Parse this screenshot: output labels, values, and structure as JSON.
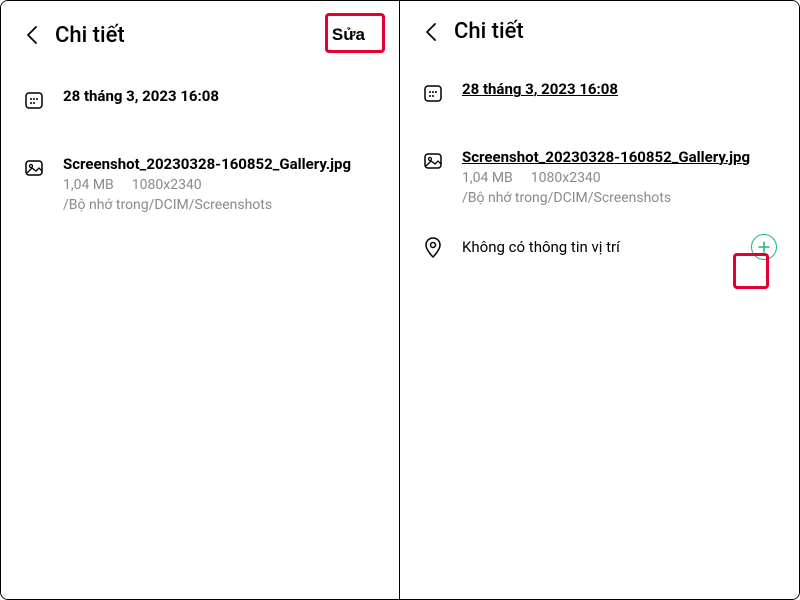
{
  "left": {
    "header_title": "Chi tiết",
    "edit_label": "Sửa",
    "date": "28 tháng 3, 2023 16:08",
    "filename": "Screenshot_20230328-160852_Gallery.jpg",
    "filesize": "1,04 MB",
    "dimensions": "1080x2340",
    "path": "/Bộ nhớ trong/DCIM/Screenshots"
  },
  "right": {
    "header_title": "Chi tiết",
    "date": "28 tháng 3, 2023 16:08",
    "filename": "Screenshot_20230328-160852_Gallery.jpg",
    "filesize": "1,04 MB",
    "dimensions": "1080x2340",
    "path": "/Bộ nhớ trong/DCIM/Screenshots",
    "location_text": "Không có thông tin vị trí"
  }
}
